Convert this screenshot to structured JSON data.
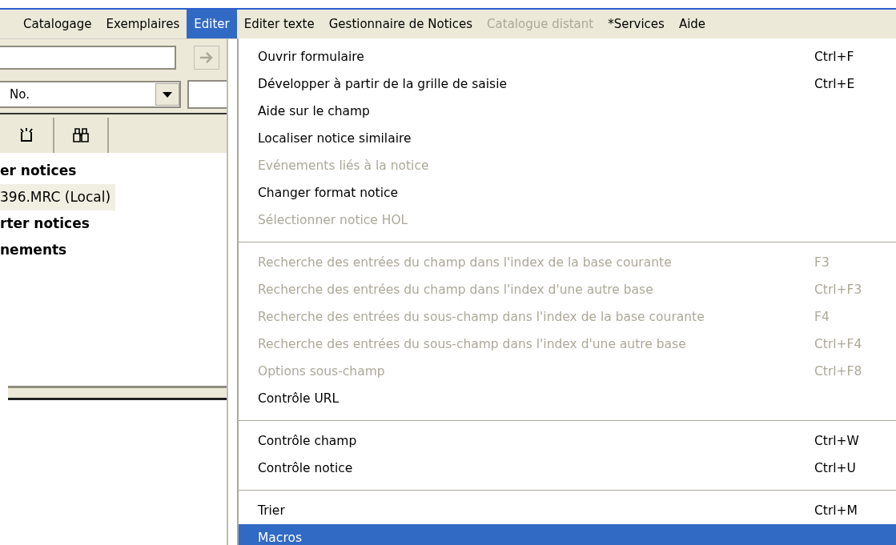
{
  "menubar": {
    "items": [
      {
        "label": "Catalogage",
        "selected": false,
        "disabled": false
      },
      {
        "label": "Exemplaires",
        "selected": false,
        "disabled": false
      },
      {
        "label": "Editer",
        "selected": true,
        "disabled": false
      },
      {
        "label": "Editer texte",
        "selected": false,
        "disabled": false
      },
      {
        "label": "Gestionnaire de Notices",
        "selected": false,
        "disabled": false
      },
      {
        "label": "Catalogue distant",
        "selected": false,
        "disabled": true
      },
      {
        "label": "*Services",
        "selected": false,
        "disabled": false
      },
      {
        "label": "Aide",
        "selected": false,
        "disabled": false
      }
    ]
  },
  "left_panel": {
    "search_combo": {
      "value": "No."
    },
    "tree": [
      {
        "label": "er notices",
        "kind": "group",
        "selected": false
      },
      {
        "label": "396.MRC (Local)",
        "kind": "file",
        "selected": true
      },
      {
        "label": "rter notices",
        "kind": "group",
        "selected": false
      },
      {
        "label": "nements",
        "kind": "group",
        "selected": false
      }
    ]
  },
  "menu": {
    "sections": [
      {
        "items": [
          {
            "label": "Ouvrir formulaire",
            "shortcut": "Ctrl+F",
            "disabled": false,
            "selected": false
          },
          {
            "label": "Développer à partir de la grille de saisie",
            "shortcut": "Ctrl+E",
            "disabled": false,
            "selected": false
          },
          {
            "label": "Aide sur le champ",
            "disabled": false,
            "selected": false
          },
          {
            "label": "Localiser notice similaire",
            "disabled": false,
            "selected": false
          },
          {
            "label": "Evénements liés à la notice",
            "disabled": true,
            "selected": false
          },
          {
            "label": "Changer format notice",
            "disabled": false,
            "selected": false
          },
          {
            "label": "Sélectionner notice HOL",
            "disabled": true,
            "selected": false
          }
        ]
      },
      {
        "items": [
          {
            "label": "Recherche des entrées du champ dans l'index de la base courante",
            "shortcut": "F3",
            "disabled": true,
            "selected": false
          },
          {
            "label": "Recherche des entrées du champ dans l'index d'une autre base",
            "shortcut": "Ctrl+F3",
            "disabled": true,
            "selected": false
          },
          {
            "label": "Recherche des entrées du sous-champ dans l'index de la base courante",
            "shortcut": "F4",
            "disabled": true,
            "selected": false
          },
          {
            "label": "Recherche des entrées du sous-champ dans l'index d'une autre base",
            "shortcut": "Ctrl+F4",
            "disabled": true,
            "selected": false
          },
          {
            "label": "Options sous-champ",
            "shortcut": "Ctrl+F8",
            "disabled": true,
            "selected": false
          },
          {
            "label": "Contrôle URL",
            "disabled": false,
            "selected": false
          }
        ]
      },
      {
        "items": [
          {
            "label": "Contrôle champ",
            "shortcut": "Ctrl+W",
            "disabled": false,
            "selected": false
          },
          {
            "label": "Contrôle notice",
            "shortcut": "Ctrl+U",
            "disabled": false,
            "selected": false
          }
        ]
      },
      {
        "items": [
          {
            "label": "Trier",
            "shortcut": "Ctrl+M",
            "disabled": false,
            "selected": false
          },
          {
            "label": "Macros",
            "disabled": false,
            "selected": true
          }
        ]
      }
    ]
  }
}
